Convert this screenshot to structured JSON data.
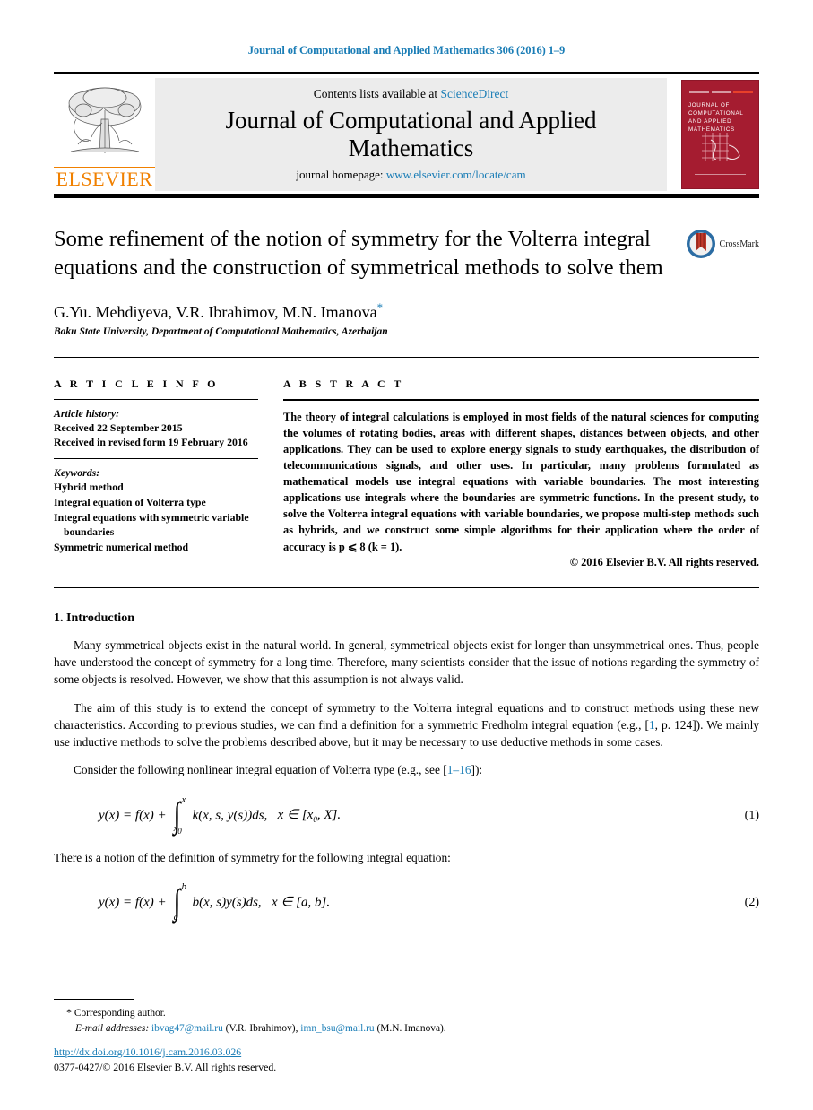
{
  "running_head": "Journal of Computational and Applied Mathematics 306 (2016) 1–9",
  "masthead": {
    "contents_prefix": "Contents lists available at ",
    "sciencedirect": "ScienceDirect",
    "journal_name": "Journal of Computational and Applied Mathematics",
    "homepage_prefix": "journal homepage: ",
    "homepage_url": "www.elsevier.com/locate/cam",
    "publisher": "ELSEVIER",
    "cover_title": "JOURNAL OF COMPUTATIONAL AND APPLIED MATHEMATICS",
    "accent_link": "#1a7db6",
    "cover_color": "#a51c30",
    "elsevier_orange": "#f08000"
  },
  "article": {
    "title": "Some refinement of the notion of symmetry for the Volterra integral equations and the construction of symmetrical methods to solve them",
    "crossmark_label": "CrossMark",
    "authors": "G.Yu. Mehdiyeva, V.R. Ibrahimov, M.N. Imanova",
    "corresponding_marker": "*",
    "affiliation": "Baku State University, Department of Computational Mathematics, Azerbaijan"
  },
  "info": {
    "heading": "A R T I C L E   I N F O",
    "history_label": "Article history:",
    "history": [
      "Received 22 September 2015",
      "Received in revised form 19 February 2016"
    ],
    "keywords_label": "Keywords:",
    "keywords": [
      "Hybrid method",
      "Integral equation of Volterra type",
      "Integral equations with symmetric variable",
      "boundaries",
      "Symmetric numerical method"
    ]
  },
  "abstract": {
    "heading": "A B S T R A C T",
    "text": "The theory of integral calculations is employed in most fields of the natural sciences for computing the volumes of rotating bodies, areas with different shapes, distances between objects, and other applications. They can be used to explore energy signals to study earthquakes, the distribution of telecommunications signals, and other uses. In particular, many problems formulated as mathematical models use integral equations with variable boundaries. The most interesting applications use integrals where the boundaries are symmetric functions. In the present study, to solve the Volterra integral equations with variable boundaries, we propose multi-step methods such as hybrids, and we construct some simple algorithms for their application where the order of accuracy is p ⩽ 8 (k = 1).",
    "copyright": "© 2016 Elsevier B.V. All rights reserved."
  },
  "body": {
    "section_number_title": "1. Introduction",
    "paragraph_1": "Many symmetrical objects exist in the natural world. In general, symmetrical objects exist for longer than unsymmetrical ones. Thus, people have understood the concept of symmetry for a long time. Therefore, many scientists consider that the issue of notions regarding the symmetry of some objects is resolved. However, we show that this assumption is not always valid.",
    "paragraph_2_part1": "The aim of this study is to extend the concept of symmetry to the Volterra integral equations and to construct methods using these new characteristics. According to previous studies, we can find a definition for a symmetric Fredholm integral equation (e.g., [",
    "paragraph_2_ref": "1",
    "paragraph_2_part2": ", p. 124]). We mainly use inductive methods to solve the problems described above, but it may be necessary to use deductive methods in some cases.",
    "paragraph_3_part1": "Consider the following nonlinear integral equation of Volterra type (e.g., see [",
    "paragraph_3_ref": "1–16",
    "paragraph_3_part2": "]):",
    "paragraph_4": "There is a notion of the definition of symmetry for the following integral equation:"
  },
  "equations": {
    "eq1": {
      "lhs": "y(x) = f(x) +",
      "lower_limit": "x0",
      "upper_limit": "x",
      "integrand": "k(x, s, y(s))ds,",
      "domain": "x ∈ [x0, X].",
      "number": "(1)"
    },
    "eq2": {
      "lhs": "y(x) = f(x) +",
      "lower_limit": "a",
      "upper_limit": "b",
      "integrand": "b(x, s)y(s)ds,",
      "domain": "x ∈ [a, b].",
      "number": "(2)"
    }
  },
  "footnotes": {
    "star": "*",
    "corresponding": "Corresponding author.",
    "email_label": "E-mail addresses:",
    "email_1": "ibvag47@mail.ru",
    "email_1_owner": "(V.R. Ibrahimov),",
    "email_2": "imn_bsu@mail.ru",
    "email_2_owner": "(M.N. Imanova)."
  },
  "footer": {
    "doi": "http://dx.doi.org/10.1016/j.cam.2016.03.026",
    "issn_line": "0377-0427/© 2016 Elsevier B.V. All rights reserved."
  }
}
